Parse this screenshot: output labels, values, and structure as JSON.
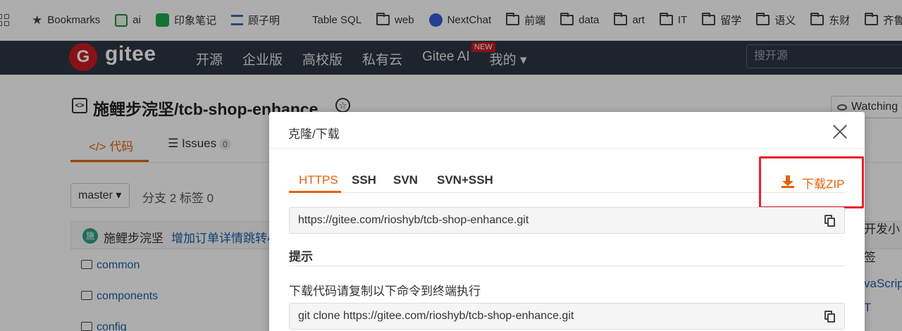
{
  "bookmarks_bar": {
    "items": [
      {
        "label": "Bookmarks",
        "icon": "star-icon"
      },
      {
        "label": "ai",
        "icon": "ai-icon"
      },
      {
        "label": "印象笔记",
        "icon": "evernote-icon"
      },
      {
        "label": "顾子明",
        "icon": "site-icon"
      },
      {
        "label": "Table SQL",
        "icon": "grid-icon"
      },
      {
        "label": "web",
        "icon": "folder-icon"
      },
      {
        "label": "NextChat",
        "icon": "nextchat-icon"
      },
      {
        "label": "前端",
        "icon": "folder-icon"
      },
      {
        "label": "data",
        "icon": "folder-icon"
      },
      {
        "label": "art",
        "icon": "folder-icon"
      },
      {
        "label": "IT",
        "icon": "folder-icon"
      },
      {
        "label": "留学",
        "icon": "folder-icon"
      },
      {
        "label": "语义",
        "icon": "folder-icon"
      },
      {
        "label": "东财",
        "icon": "folder-icon"
      },
      {
        "label": "齐鲁",
        "icon": "folder-icon"
      }
    ]
  },
  "gitee_header": {
    "logo_letter": "G",
    "logo_text": "gitee",
    "nav": [
      "开源",
      "企业版",
      "高校版",
      "私有云",
      "Gitee AI",
      "我的 ▾"
    ],
    "new_badge": "NEW",
    "search_placeholder": "搜开源"
  },
  "repo": {
    "title": "施鲤步浣坚/tcb-shop-enhance",
    "watch_label": "Watching",
    "tab_code": "代码",
    "tab_issues": "Issues",
    "issues_count": "0",
    "branch": "master ▾",
    "branch_info": "分支 2   标签 0",
    "commit_author": "施鲤步浣坚",
    "commit_avatar": "施",
    "commit_message": "增加订单详情跳转小",
    "files": [
      "common",
      "components",
      "config"
    ],
    "side_texts": [
      "开发小",
      "签"
    ],
    "side_links": [
      "vaScript",
      "T"
    ]
  },
  "modal": {
    "title": "克隆/下载",
    "protocol_tabs": [
      "HTTPS",
      "SSH",
      "SVN",
      "SVN+SSH"
    ],
    "active_tab": "HTTPS",
    "download_zip_label": "下载ZIP",
    "clone_url": "https://gitee.com/rioshyb/tcb-shop-enhance.git",
    "tip_title": "提示",
    "tip_text": "下载代码请复制以下命令到终端执行",
    "clone_command": "git clone https://gitee.com/rioshyb/tcb-shop-enhance.git",
    "colors": {
      "accent": "#e36209",
      "highlight": "#e8202a",
      "header_bg": "#2d3545"
    }
  }
}
